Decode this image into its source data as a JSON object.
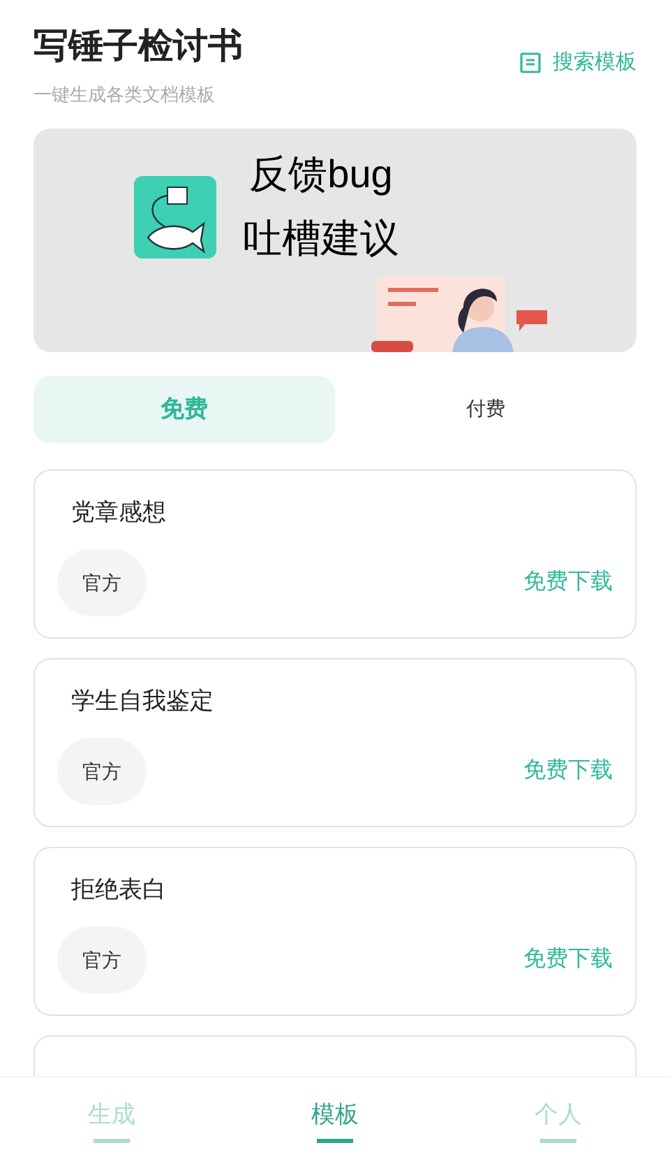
{
  "header": {
    "title": "写锤子检讨书",
    "subtitle": "一键生成各类文档模板",
    "search_button": "搜索模板"
  },
  "banner": {
    "line_1": "反馈bug",
    "line_2": "吐槽建议"
  },
  "tabs": [
    {
      "label": "免费",
      "selected": true
    },
    {
      "label": "付费",
      "selected": false
    }
  ],
  "templates": [
    {
      "title": "党章感想",
      "tag": "官方",
      "action": "免费下载"
    },
    {
      "title": "学生自我鉴定",
      "tag": "官方",
      "action": "免费下载"
    },
    {
      "title": "拒绝表白",
      "tag": "官方",
      "action": "免费下载"
    },
    {
      "kind": "partial"
    }
  ],
  "bottom_nav": [
    {
      "label": "生成",
      "selected": false
    },
    {
      "label": "模板",
      "selected": true
    },
    {
      "label": "个人",
      "selected": false
    }
  ]
}
